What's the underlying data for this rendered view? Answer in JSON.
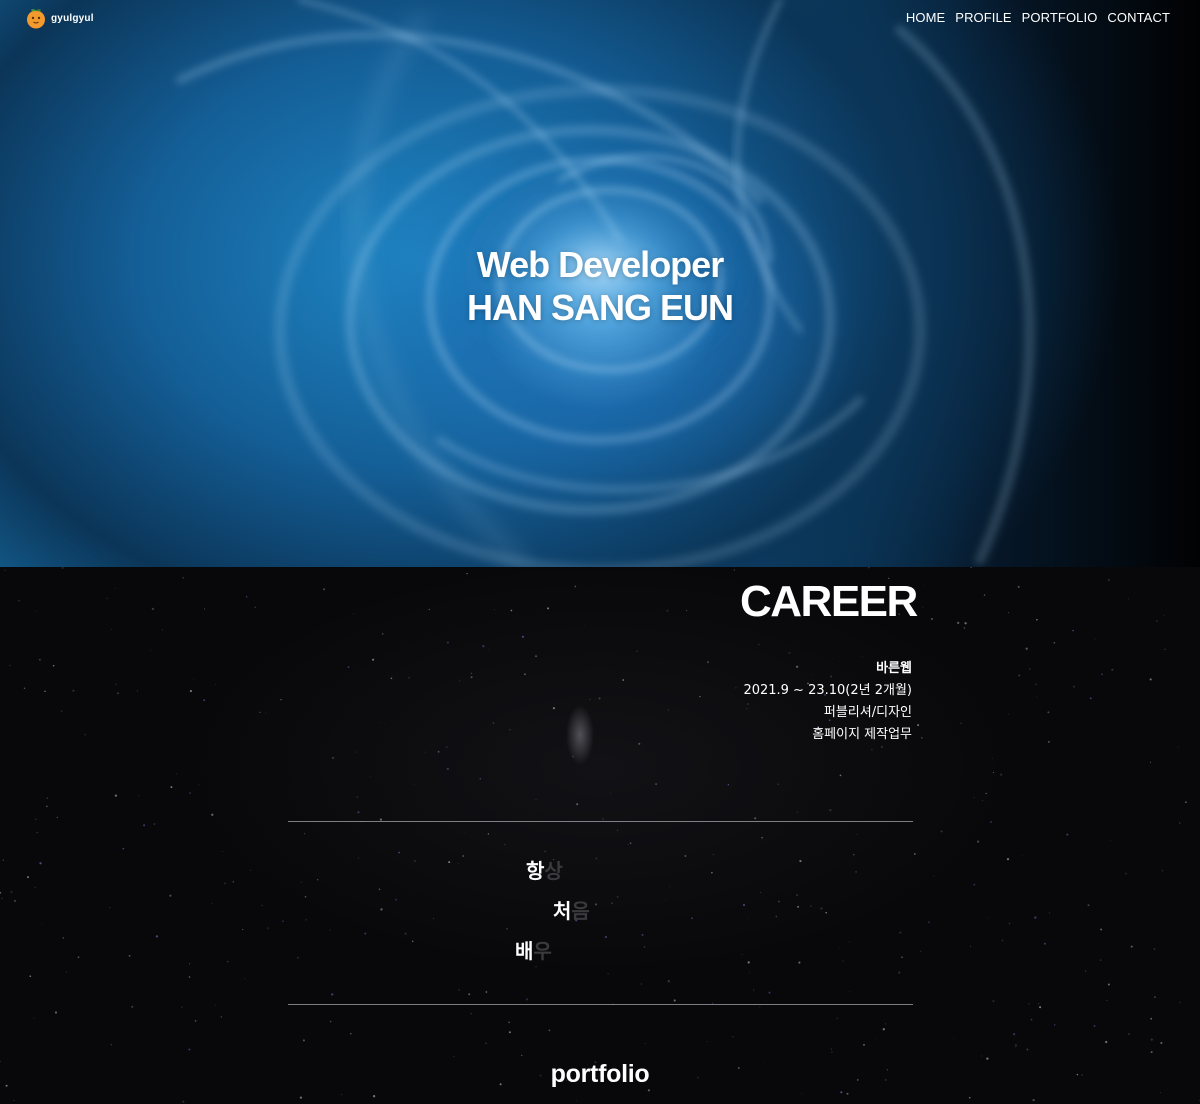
{
  "header": {
    "logo_text": "gyulgyul",
    "nav": [
      "HOME",
      "PROFILE",
      "PORTFOLIO",
      "CONTACT"
    ]
  },
  "hero": {
    "line1": "Web Developer",
    "line2": "HAN SANG EUN"
  },
  "career": {
    "title": "CAREER",
    "company": "바른웹",
    "period": "2021.9 ~ 23.10(2년 2개월)",
    "role": "퍼블리셔/디자인",
    "duty": "홈페이지 제작업무"
  },
  "motto": [
    {
      "lit": "항",
      "dim": "상"
    },
    {
      "lit": "처",
      "dim": "음"
    },
    {
      "lit": "배",
      "dim": "우"
    }
  ],
  "portfolio": {
    "heading": "portfolio"
  },
  "colors": {
    "hero_blue": "#1a79b4",
    "background": "#070708",
    "text": "#ffffff",
    "dim_text": "#3a3a3e",
    "logo_orange": "#f29a2e"
  }
}
